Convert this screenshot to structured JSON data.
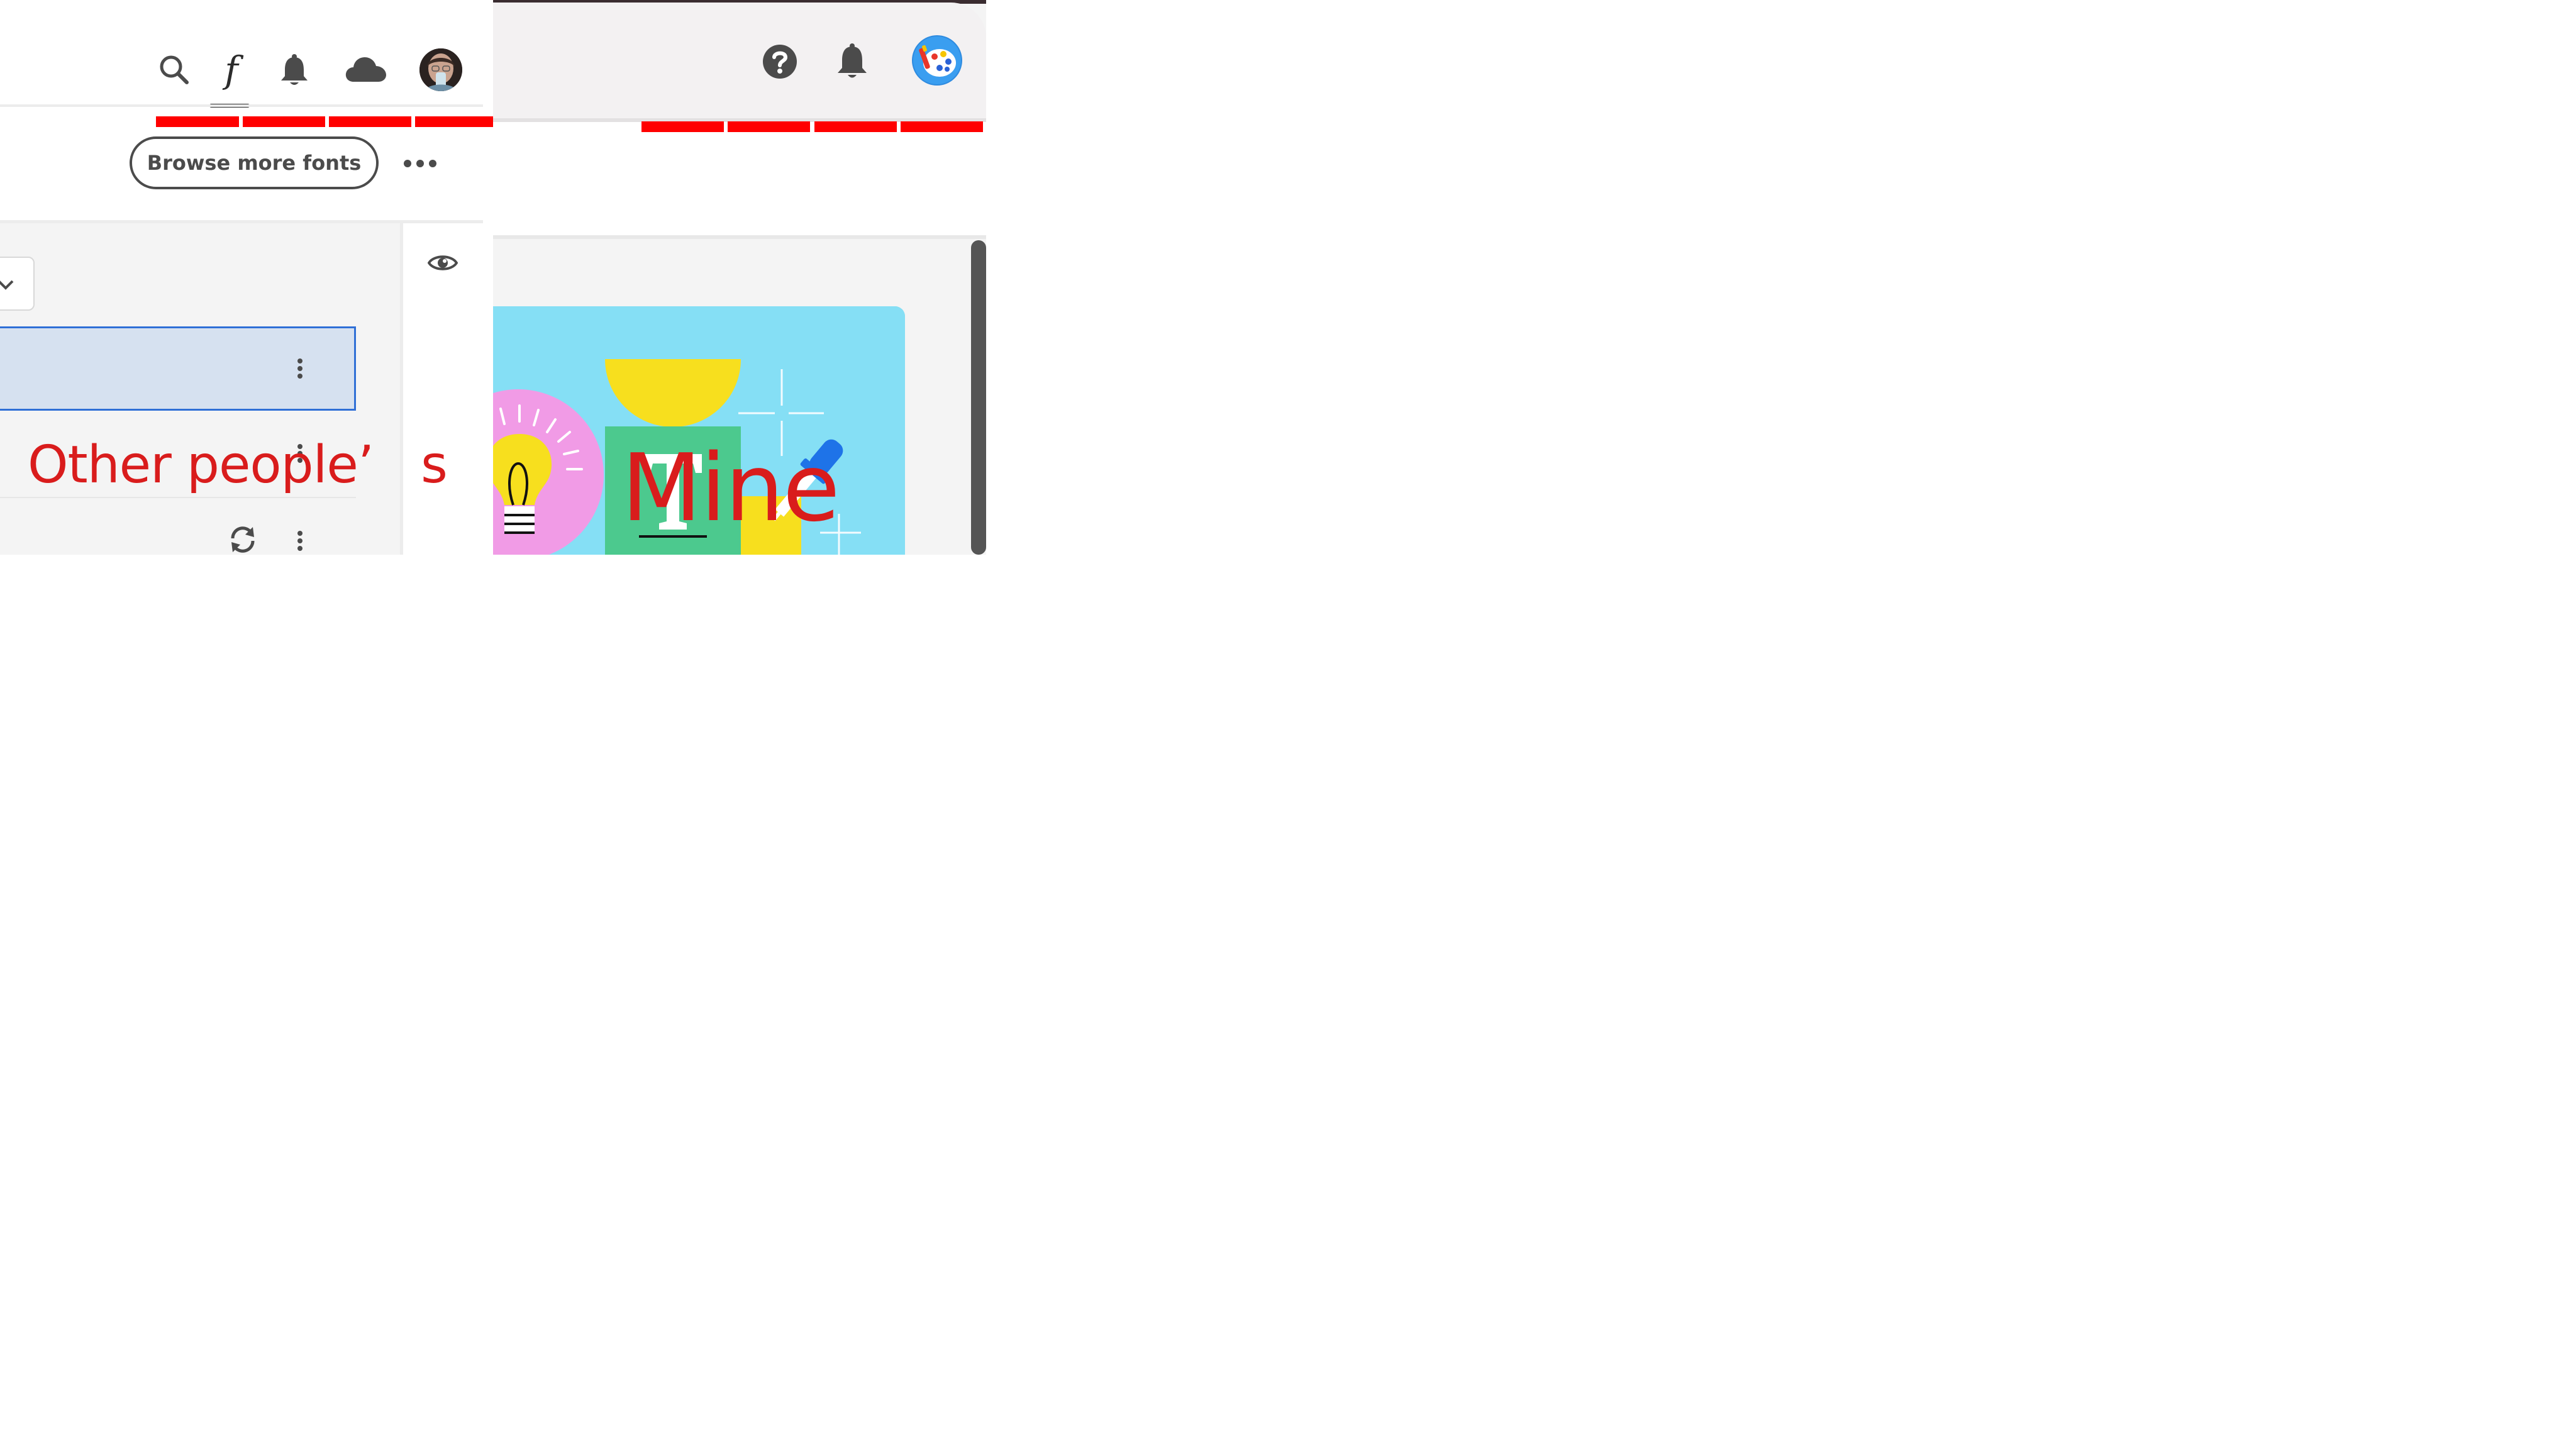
{
  "left_panel": {
    "header_icons": [
      "search-icon",
      "fonts-f-icon",
      "bell-icon",
      "cloud-icon",
      "user-avatar"
    ],
    "active_tab_glyph": "f",
    "browse_button_label": "Browse more fonts",
    "more_menu_icon": "more-horizontal-icon",
    "preview_toggle_icon": "eye-icon",
    "annotation_text": "Other people’   s"
  },
  "right_panel": {
    "header_icons": [
      "help-icon",
      "bell-icon",
      "user-avatar-palette"
    ],
    "annotation_text": "Mine"
  },
  "colors": {
    "annotation_red": "#d91c1c",
    "redaction_red": "#ff0000",
    "selection_blue": "#2f6fd6",
    "selection_fill": "#d6e1f0",
    "art_background": "#85dff5"
  }
}
